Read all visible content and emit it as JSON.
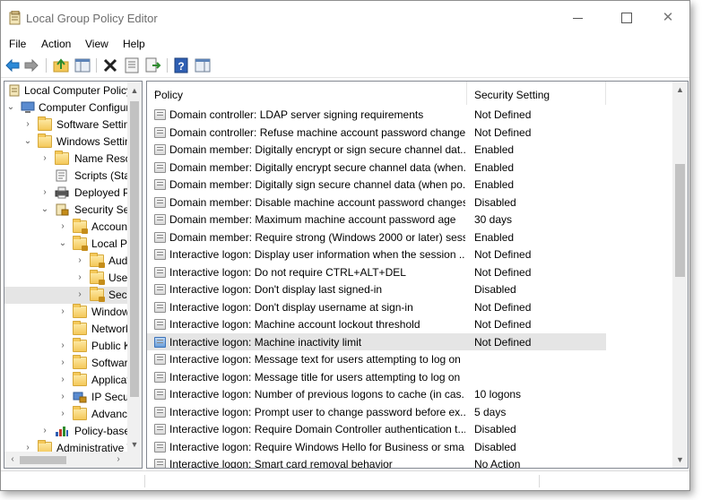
{
  "window": {
    "title": "Local Group Policy Editor",
    "controls": {
      "close_glyph": "✕"
    }
  },
  "menu": [
    "File",
    "Action",
    "View",
    "Help"
  ],
  "toolbar": {
    "icons": [
      "back-arrow-icon",
      "forward-arrow-icon",
      "up-folder-icon",
      "show-hide-tree-icon",
      "delete-icon",
      "properties-icon",
      "export-list-icon",
      "help-icon",
      "show-hide-action-pane-icon"
    ]
  },
  "tree": {
    "items": [
      {
        "label": "Local Computer Policy",
        "expander": ""
      },
      {
        "label": "Computer Configuration",
        "expander": "⌄"
      },
      {
        "label": "Software Settings",
        "expander": "›"
      },
      {
        "label": "Windows Settings",
        "expander": "⌄"
      },
      {
        "label": "Name Resolution Policy",
        "expander": "›"
      },
      {
        "label": "Scripts (Startup/Shutdown)",
        "expander": ""
      },
      {
        "label": "Deployed Printers",
        "expander": "›"
      },
      {
        "label": "Security Settings",
        "expander": "⌄"
      },
      {
        "label": "Account Policies",
        "expander": "›"
      },
      {
        "label": "Local Policies",
        "expander": "⌄"
      },
      {
        "label": "Audit Policy",
        "expander": "›"
      },
      {
        "label": "User Rights Assignment",
        "expander": "›"
      },
      {
        "label": "Security Options",
        "expander": "›"
      },
      {
        "label": "Windows Defender Firewall",
        "expander": "›"
      },
      {
        "label": "Network List Manager Policies",
        "expander": ""
      },
      {
        "label": "Public Key Policies",
        "expander": "›"
      },
      {
        "label": "Software Restriction Policies",
        "expander": "›"
      },
      {
        "label": "Application Control Policies",
        "expander": "›"
      },
      {
        "label": "IP Security Policies on Local Computer",
        "expander": "›"
      },
      {
        "label": "Advanced Audit Policy Configuration",
        "expander": "›"
      },
      {
        "label": "Policy-based QoS",
        "expander": "›"
      },
      {
        "label": "Administrative Templates",
        "expander": "›"
      }
    ]
  },
  "columns": {
    "policy": "Policy",
    "setting": "Security Setting"
  },
  "policies": [
    {
      "name": "Domain controller: LDAP server signing requirements",
      "setting": "Not Defined"
    },
    {
      "name": "Domain controller: Refuse machine account password changes",
      "setting": "Not Defined"
    },
    {
      "name": "Domain member: Digitally encrypt or sign secure channel dat...",
      "setting": "Enabled"
    },
    {
      "name": "Domain member: Digitally encrypt secure channel data (when...",
      "setting": "Enabled"
    },
    {
      "name": "Domain member: Digitally sign secure channel data (when po...",
      "setting": "Enabled"
    },
    {
      "name": "Domain member: Disable machine account password changes",
      "setting": "Disabled"
    },
    {
      "name": "Domain member: Maximum machine account password age",
      "setting": "30 days"
    },
    {
      "name": "Domain member: Require strong (Windows 2000 or later) sess...",
      "setting": "Enabled"
    },
    {
      "name": "Interactive logon: Display user information when the session ...",
      "setting": "Not Defined"
    },
    {
      "name": "Interactive logon: Do not require CTRL+ALT+DEL",
      "setting": "Not Defined"
    },
    {
      "name": "Interactive logon: Don't display last signed-in",
      "setting": "Disabled"
    },
    {
      "name": "Interactive logon: Don't display username at sign-in",
      "setting": "Not Defined"
    },
    {
      "name": "Interactive logon: Machine account lockout threshold",
      "setting": "Not Defined"
    },
    {
      "name": "Interactive logon: Machine inactivity limit",
      "setting": "Not Defined",
      "selected": true
    },
    {
      "name": "Interactive logon: Message text for users attempting to log on",
      "setting": ""
    },
    {
      "name": "Interactive logon: Message title for users attempting to log on",
      "setting": ""
    },
    {
      "name": "Interactive logon: Number of previous logons to cache (in cas...",
      "setting": "10 logons"
    },
    {
      "name": "Interactive logon: Prompt user to change password before ex...",
      "setting": "5 days"
    },
    {
      "name": "Interactive logon: Require Domain Controller authentication t...",
      "setting": "Disabled"
    },
    {
      "name": "Interactive logon: Require Windows Hello for Business or sma...",
      "setting": "Disabled"
    },
    {
      "name": "Interactive logon: Smart card removal behavior",
      "setting": "No Action"
    }
  ],
  "colors": {
    "selection": "#e5e5e5",
    "border": "#828790",
    "scrollbar_thumb": "#c2c2c2"
  }
}
